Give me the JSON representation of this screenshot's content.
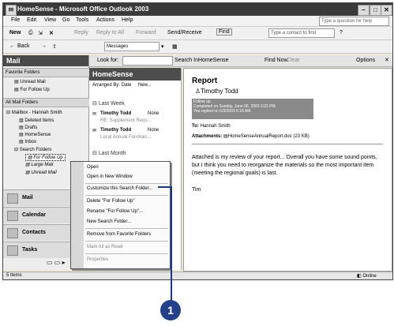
{
  "window": {
    "title": "HomeSense - Microsoft Office Outlook 2003"
  },
  "menubar": {
    "items": [
      "File",
      "Edit",
      "View",
      "Go",
      "Tools",
      "Actions",
      "Help"
    ],
    "help_placeholder": "Type a question for help"
  },
  "toolbar1": {
    "new": "New",
    "reply": "Reply",
    "reply_all": "Reply to All",
    "forward": "Forward",
    "send_receive": "Send/Receive",
    "find": "Find",
    "contact_placeholder": "Type a contact to find"
  },
  "toolbar2": {
    "back": "Back",
    "messages": "Messages"
  },
  "findbar": {
    "look_for": "Look for:",
    "search_in": "Search In",
    "search_in_value": "HomeSense",
    "find_now": "Find Now",
    "clear": "Clear",
    "options": "Options"
  },
  "nav": {
    "title": "Mail",
    "favorites_header": "Favorite Folders",
    "favorites": [
      "Unread Mail",
      "For Follow Up"
    ],
    "all_header": "All Mail Folders",
    "tree": [
      "Mailbox - Hannah Smith",
      "Deleted Items",
      "Drafts",
      "HomeSense",
      "Inbox",
      "Search Folders",
      "For Follow Up",
      "Large Mail",
      "Unread Mail"
    ],
    "buttons": [
      "Mail",
      "Calendar",
      "Contacts",
      "Tasks"
    ]
  },
  "list": {
    "title": "HomeSense",
    "arranged": "Arranged By: Date",
    "sort": "New...",
    "group1": "Last Week",
    "items": [
      {
        "from": "Timothy Todd",
        "flag": "None",
        "subject": "RE: Supplement Requ..."
      },
      {
        "from": "Timothy Todd",
        "flag": "None",
        "subject": "Local Annual Fundrais..."
      }
    ],
    "group2": "Last Month"
  },
  "reading": {
    "subject": "Report",
    "sender": "Timothy Todd",
    "flag_line1": "Follow up.",
    "flag_line2": "Completed on Sunday, June 06, 2003 3:23 PM.",
    "flag_line3": "You replied on 6/3/2003 6:18 AM.",
    "to_label": "To:",
    "to_value": "Hannah Smith",
    "attach_label": "Attachments:",
    "attach_value": "HomeSenseAnnualReport.doc (23 KB)",
    "body": "Attached is my review of your report... Overall you have some sound points, but I think you need to reorganize the materials so the most important item (meeting the regional goals) is last.",
    "sign": "Tim"
  },
  "context_menu": {
    "items": [
      "Open",
      "Open in New Window",
      "Customize this Search Folder...",
      "Delete \"For Follow Up\"",
      "Rename \"For Follow Up\"...",
      "New Search Folder...",
      "Remove from Favorite Folders",
      "Mark All as Read",
      "Properties"
    ]
  },
  "status": {
    "items": "5 Items",
    "online": "Online"
  },
  "callout": {
    "number": "1"
  }
}
